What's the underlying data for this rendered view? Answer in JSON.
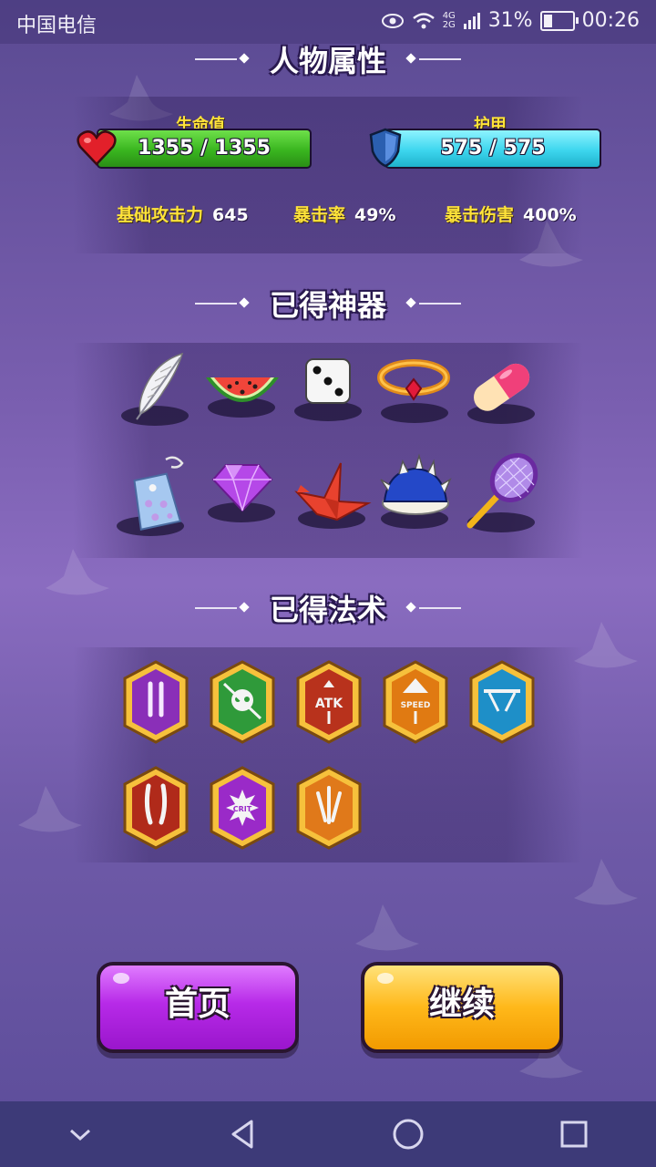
{
  "status_bar": {
    "carrier": "中国电信",
    "network": "4G 2G",
    "battery": "31%",
    "battery_level": 0.31,
    "time": "00:26"
  },
  "sections": {
    "attributes_title": "人物属性",
    "artifacts_title": "已得神器",
    "spells_title": "已得法术"
  },
  "hp": {
    "label": "生命值",
    "value": "1355 / 1355",
    "fill": 1.0
  },
  "armor": {
    "label": "护甲",
    "value": "575 / 575",
    "fill": 1.0
  },
  "attributes": [
    {
      "label": "基础攻击力",
      "value": "645"
    },
    {
      "label": "暴击率",
      "value": "49%"
    },
    {
      "label": "暴击伤害",
      "value": "400%"
    }
  ],
  "artifacts": [
    "feather-icon",
    "watermelon-icon",
    "dice-icon",
    "ruby-ring-icon",
    "capsule-icon",
    "omamori-charm-icon",
    "diamond-icon",
    "paper-crane-icon",
    "spiny-shell-icon",
    "tennis-racket-icon"
  ],
  "spells": [
    {
      "icon": "double-shot-icon",
      "color": "#8a2fb8"
    },
    {
      "icon": "poison-skull-icon",
      "color": "#2f9a3a"
    },
    {
      "icon": "atk-up-icon",
      "color": "#b8321c",
      "text": "ATK"
    },
    {
      "icon": "speed-up-icon",
      "color": "#e07a12",
      "text": "SPEED"
    },
    {
      "icon": "arrow-split-icon",
      "color": "#1e8fc8"
    },
    {
      "icon": "twin-claw-icon",
      "color": "#b02a1a"
    },
    {
      "icon": "crit-burst-icon",
      "color": "#9a2ac8",
      "text": "CRIT"
    },
    {
      "icon": "triple-shot-icon",
      "color": "#e0791a"
    }
  ],
  "buttons": {
    "home": "首页",
    "continue": "继续"
  },
  "nav": {
    "back": "back-icon",
    "home": "home-icon",
    "recents": "recents-icon",
    "collapse": "chevron-down-icon"
  }
}
